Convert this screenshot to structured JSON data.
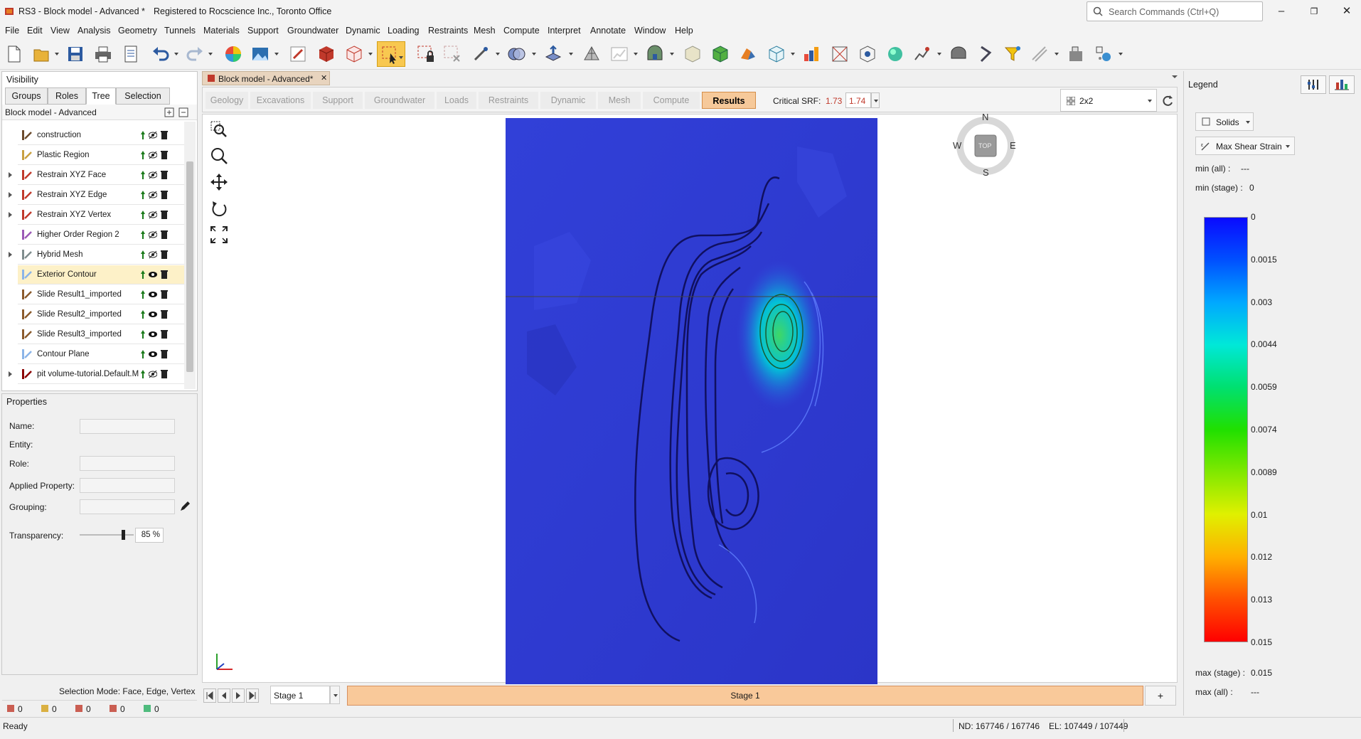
{
  "titlebar": {
    "app_title": "RS3 - Block model - Advanced *",
    "registration": "Registered to Rocscience Inc., Toronto Office",
    "search_placeholder": "Search Commands (Ctrl+Q)",
    "minimize": "–",
    "restore": "❐",
    "close": "✕"
  },
  "menu": [
    "File",
    "Edit",
    "View",
    "Analysis",
    "Geometry",
    "Tunnels",
    "Materials",
    "Support",
    "Groundwater",
    "Dynamic",
    "Loading",
    "Restraints",
    "Mesh",
    "Compute",
    "Interpret",
    "Annotate",
    "Window",
    "Help"
  ],
  "visibility": {
    "title": "Visibility",
    "tabs": [
      "Groups",
      "Roles",
      "Tree",
      "Selection"
    ],
    "active_tab": "Tree",
    "tree_title": "Block model - Advanced",
    "items": [
      {
        "label": "construction",
        "icon": "construction-icon",
        "color": "#6b4a2b",
        "expandable": false
      },
      {
        "label": "Plastic Region",
        "icon": "plastic-region-icon",
        "color": "#c8a040",
        "expandable": false
      },
      {
        "label": "Restrain XYZ Face",
        "icon": "restraint-icon",
        "color": "#c0392b",
        "expandable": true
      },
      {
        "label": "Restrain XYZ Edge",
        "icon": "restraint-icon",
        "color": "#c0392b",
        "expandable": true
      },
      {
        "label": "Restrain XYZ Vertex",
        "icon": "restraint-icon",
        "color": "#c0392b",
        "expandable": true
      },
      {
        "label": "Higher Order Region 2",
        "icon": "cube-icon",
        "color": "#9b59b6",
        "expandable": false
      },
      {
        "label": "Hybrid Mesh",
        "icon": "mesh-icon",
        "color": "#7f8c8d",
        "expandable": true
      },
      {
        "label": "Exterior Contour",
        "icon": "contour-icon",
        "color": "#8ab4e8",
        "expandable": false,
        "selected": true
      },
      {
        "label": "Slide Result1_imported",
        "icon": "slide-result-icon",
        "color": "#8b5a2b",
        "expandable": false
      },
      {
        "label": "Slide Result2_imported",
        "icon": "slide-result-icon",
        "color": "#8b5a2b",
        "expandable": false
      },
      {
        "label": "Slide Result3_imported",
        "icon": "slide-result-icon",
        "color": "#8b5a2b",
        "expandable": false
      },
      {
        "label": "Contour Plane",
        "icon": "contour-icon",
        "color": "#8ab4e8",
        "expandable": false
      },
      {
        "label": "pit volume-tutorial.Default.M",
        "icon": "material-icon",
        "color": "#8b0000",
        "expandable": true
      }
    ]
  },
  "properties": {
    "title": "Properties",
    "name_label": "Name:",
    "entity_label": "Entity:",
    "role_label": "Role:",
    "applied_property_label": "Applied Property:",
    "grouping_label": "Grouping:",
    "transparency_label": "Transparency:",
    "transparency_value": "85 %",
    "transparency_fraction": 0.85,
    "selection_mode": "Selection Mode: Face, Edge, Vertex",
    "counters": [
      {
        "icon": "vertex-count-icon",
        "value": "0",
        "color": "#c0392b"
      },
      {
        "icon": "edge-count-icon",
        "value": "0",
        "color": "#d4a017"
      },
      {
        "icon": "face-count-icon",
        "value": "0",
        "color": "#c0392b"
      },
      {
        "icon": "solid-count-icon",
        "value": "0",
        "color": "#c0392b"
      },
      {
        "icon": "group-count-icon",
        "value": "0",
        "color": "#27ae60"
      }
    ]
  },
  "document_tab": {
    "label": "Block model - Advanced*",
    "close": "✕"
  },
  "workflow": {
    "steps": [
      "Geology",
      "Excavations",
      "Support",
      "Groundwater",
      "Loads",
      "Restraints",
      "Dynamic",
      "Mesh",
      "Compute",
      "Results"
    ],
    "active": "Results",
    "critical_srf_label": "Critical SRF:",
    "critical_srf_value": "1.73",
    "critical_srf_select": "1.74",
    "layout_select": "2x2"
  },
  "view_tools": [
    "zoom-window-icon",
    "zoom-icon",
    "pan-icon",
    "rotate-icon",
    "zoom-extents-icon"
  ],
  "compass": {
    "n": "N",
    "s": "S",
    "e": "E",
    "w": "W",
    "top": "TOP"
  },
  "stage": {
    "select": "Stage 1",
    "current": "Stage 1",
    "add": "+"
  },
  "status": {
    "ready": "Ready",
    "nodes": "ND: 167746 / 167746",
    "elements": "EL: 107449 / 107449"
  },
  "legend": {
    "title": "Legend",
    "display_select": "Solids",
    "data_select": "Max Shear Strain",
    "min_all_label": "min (all) :",
    "min_all_value": "---",
    "min_stage_label": "min (stage) :",
    "min_stage_value": "0",
    "max_stage_label": "max (stage) :",
    "max_stage_value": "0.015",
    "max_all_label": "max (all) :",
    "max_all_value": "---",
    "ticks": [
      "0",
      "0.0015",
      "0.003",
      "0.0044",
      "0.0059",
      "0.0074",
      "0.0089",
      "0.01",
      "0.012",
      "0.013",
      "0.015"
    ],
    "colors": [
      "#0a0aff",
      "#0050ff",
      "#00a8ff",
      "#00e8d8",
      "#00e070",
      "#20e000",
      "#80e800",
      "#e0f000",
      "#ffb000",
      "#ff5000",
      "#ff0000"
    ]
  }
}
